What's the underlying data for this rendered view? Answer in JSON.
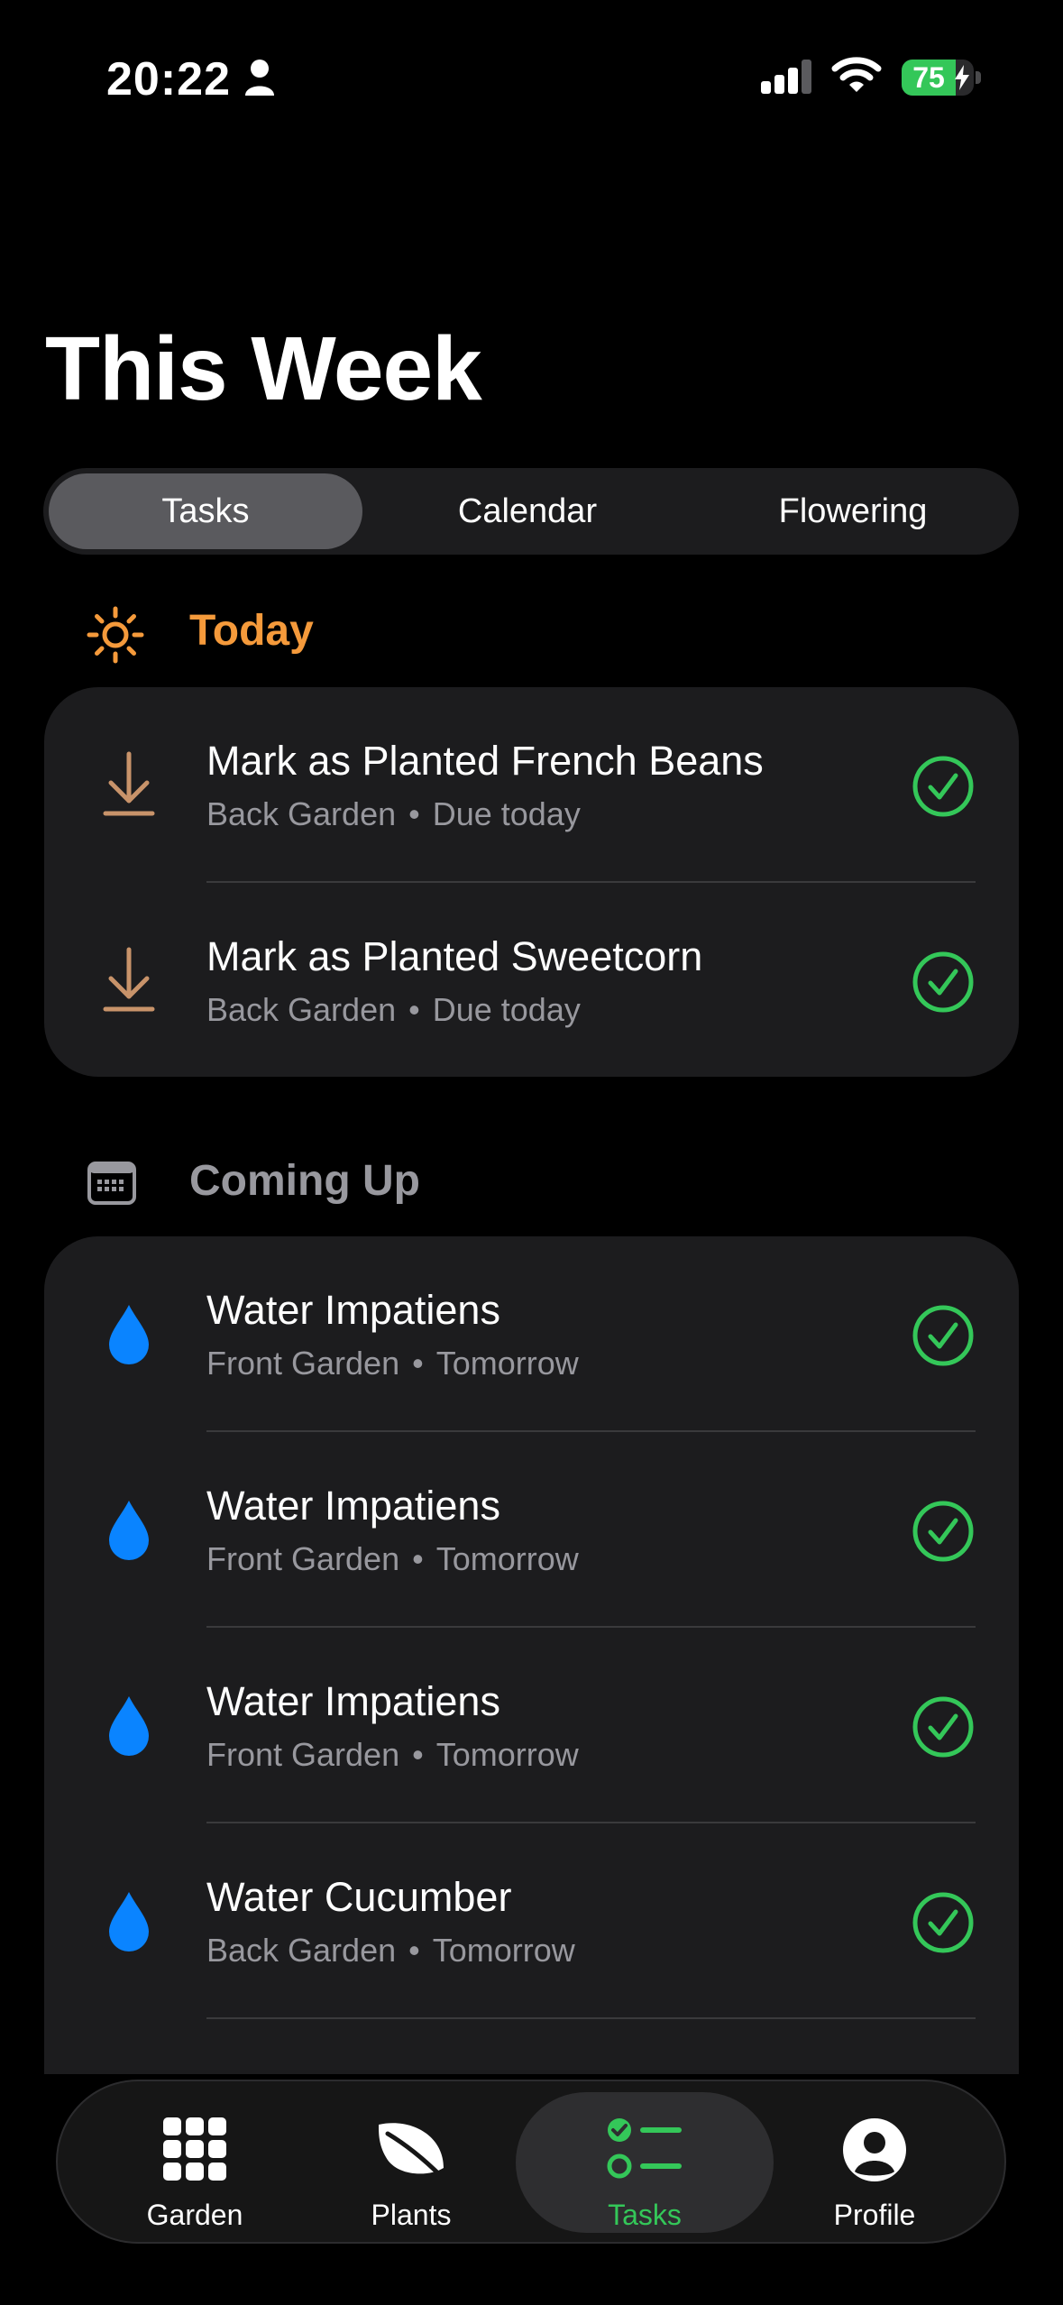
{
  "status_bar": {
    "time": "20:22",
    "battery_percent": "75",
    "battery_level": 0.75,
    "icons": [
      "person-icon",
      "cellular-signal-icon",
      "wifi-icon",
      "battery-charging-icon"
    ]
  },
  "header": {
    "title": "This Week"
  },
  "segmented": {
    "selected": "Tasks",
    "options": [
      "Tasks",
      "Calendar",
      "Flowering"
    ]
  },
  "sections": {
    "today": {
      "label": "Today",
      "icon": "sun-icon",
      "color": "#f59a3b",
      "tasks": [
        {
          "title": "Mark as Planted French Beans",
          "location": "Back Garden",
          "due": "Due today",
          "icon": "planted-arrow-icon"
        },
        {
          "title": "Mark as Planted Sweetcorn",
          "location": "Back Garden",
          "due": "Due today",
          "icon": "planted-arrow-icon"
        }
      ]
    },
    "coming_up": {
      "label": "Coming Up",
      "icon": "calendar-icon",
      "color": "#98989e",
      "tasks": [
        {
          "title": "Water Impatiens",
          "location": "Front Garden",
          "due": "Tomorrow",
          "icon": "water-drop-icon"
        },
        {
          "title": "Water Impatiens",
          "location": "Front Garden",
          "due": "Tomorrow",
          "icon": "water-drop-icon"
        },
        {
          "title": "Water Impatiens",
          "location": "Front Garden",
          "due": "Tomorrow",
          "icon": "water-drop-icon"
        },
        {
          "title": "Water Cucumber",
          "location": "Back Garden",
          "due": "Tomorrow",
          "icon": "water-drop-icon"
        }
      ]
    }
  },
  "separator_glyph": "•",
  "tab_bar": {
    "selected": "Tasks",
    "tabs": [
      {
        "label": "Garden",
        "icon": "grid-icon"
      },
      {
        "label": "Plants",
        "icon": "leaf-icon"
      },
      {
        "label": "Tasks",
        "icon": "checklist-icon"
      },
      {
        "label": "Profile",
        "icon": "profile-icon"
      }
    ]
  },
  "colors": {
    "background": "#000000",
    "card": "#1c1c1e",
    "accent_green": "#34c759",
    "today_orange": "#f59a3b",
    "planted_icon": "#c8936a",
    "water_blue": "#0a84ff",
    "secondary_text": "#98989e"
  }
}
